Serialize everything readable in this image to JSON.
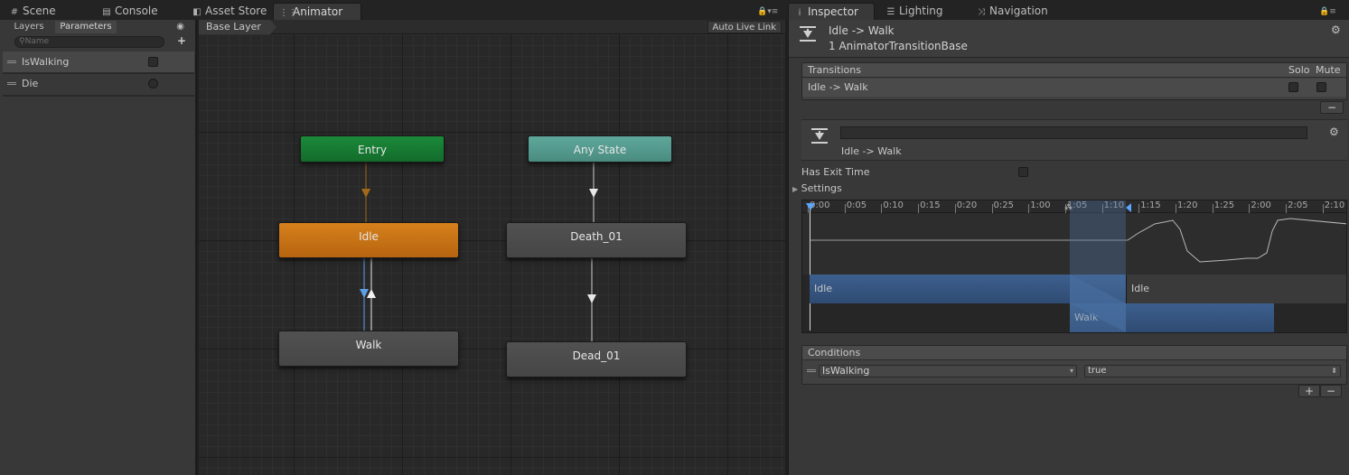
{
  "left_tabs": [
    {
      "label": "Scene",
      "icon": "#"
    },
    {
      "label": "Console",
      "icon": "▤"
    },
    {
      "label": "Asset Store",
      "icon": "◧"
    },
    {
      "label": "Animator",
      "icon": "⋮⋮"
    }
  ],
  "right_tabs": [
    {
      "label": "Inspector",
      "icon": "i"
    },
    {
      "label": "Lighting",
      "icon": "☰"
    },
    {
      "label": "Navigation",
      "icon": "⤨"
    }
  ],
  "params_panel": {
    "subtabs": [
      "Layers",
      "Parameters"
    ],
    "search_placeholder": "Name",
    "add_label": "+",
    "parameters": [
      {
        "name": "IsWalking",
        "type": "bool"
      },
      {
        "name": "Die",
        "type": "trigger"
      }
    ]
  },
  "graph": {
    "breadcrumb": "Base Layer",
    "auto_live_link": "Auto Live Link",
    "states": {
      "entry": "Entry",
      "any_state": "Any State",
      "idle": "Idle",
      "walk": "Walk",
      "death": "Death_01",
      "dead": "Dead_01"
    }
  },
  "inspector": {
    "title": "Idle -> Walk",
    "subtitle": "1 AnimatorTransitionBase",
    "transitions_header": "Transitions",
    "solo_label": "Solo",
    "mute_label": "Mute",
    "transition_row": "Idle -> Walk",
    "remove_label": "−",
    "transition_name": "Idle -> Walk",
    "has_exit_time_label": "Has Exit Time",
    "settings_label": "Settings",
    "timeline_ticks": [
      "0:00",
      "0:05",
      "0:10",
      "0:15",
      "0:20",
      "0:25",
      "1:00",
      "1:05",
      "1:10",
      "1:15",
      "1:20",
      "1:25",
      "2:00",
      "2:05",
      "2:10"
    ],
    "track_source": "Idle",
    "track_source_next": "Idle",
    "track_dest": "Walk",
    "conditions_header": "Conditions",
    "condition_param": "IsWalking",
    "condition_value": "true",
    "add_label": "+",
    "remove_condition_label": "−"
  },
  "colors": {
    "entry": "#1b8a3a",
    "any_state": "#5fa89c",
    "idle_selected": "#d6801c",
    "state_default": "#4b4b4b",
    "transition_selected": "#5da0e8"
  }
}
